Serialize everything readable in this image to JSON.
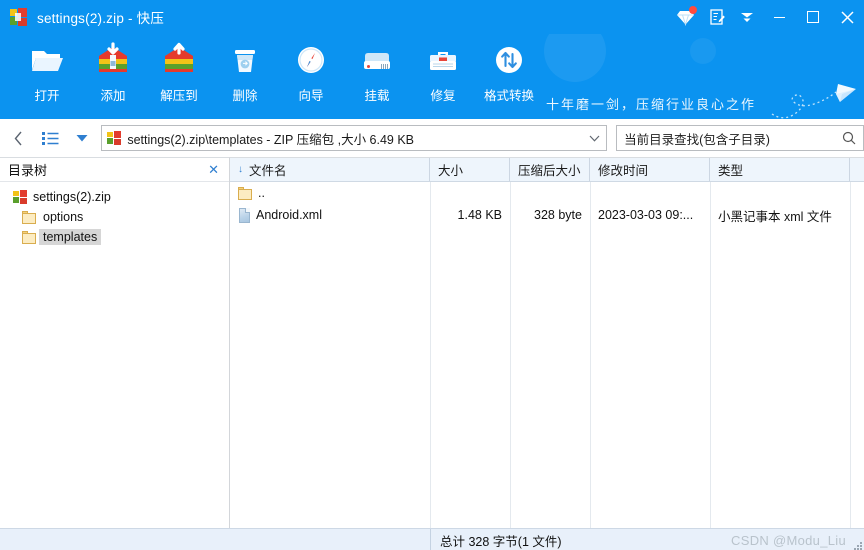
{
  "window": {
    "title": "settings(2).zip - 快压",
    "app_icon": "zip-archive-icon",
    "controls": {
      "vip": "vip-diamond-icon",
      "feedback": "feedback-note-icon",
      "menu": "chevron-down-icon",
      "minimize": "minimize-icon",
      "maximize": "maximize-icon",
      "close": "close-icon"
    }
  },
  "toolbar": {
    "buttons": [
      {
        "label": "打开",
        "icon": "open-folder-icon"
      },
      {
        "label": "添加",
        "icon": "add-archive-icon"
      },
      {
        "label": "解压到",
        "icon": "extract-archive-icon"
      },
      {
        "label": "删除",
        "icon": "trash-icon"
      },
      {
        "label": "向导",
        "icon": "compass-icon"
      },
      {
        "label": "挂载",
        "icon": "mount-disk-icon"
      },
      {
        "label": "修复",
        "icon": "toolbox-repair-icon"
      },
      {
        "label": "格式转换",
        "icon": "convert-arrows-icon"
      }
    ],
    "slogan": "十年磨一剑，压缩行业良心之作"
  },
  "address": {
    "back_icon": "back-chevron-icon",
    "list_icon": "list-view-icon",
    "dropdown_icon": "dropdown-triangle-icon",
    "path": "settings(2).zip\\templates - ZIP 压缩包 ,大小 6.49 KB",
    "path_icon": "zip-archive-icon",
    "caret_icon": "chevron-down-icon"
  },
  "search": {
    "placeholder": "当前目录查找(包含子目录)",
    "icon": "search-icon"
  },
  "tree": {
    "title": "目录树",
    "close_label": "✕",
    "nodes": [
      {
        "label": "settings(2).zip",
        "icon": "zip-archive-icon",
        "level": 1,
        "selected": false
      },
      {
        "label": "options",
        "icon": "folder-icon",
        "level": 2,
        "selected": false
      },
      {
        "label": "templates",
        "icon": "folder-icon",
        "level": 2,
        "selected": true
      }
    ]
  },
  "filelist": {
    "columns": [
      {
        "key": "name",
        "label": "文件名",
        "sorted": true
      },
      {
        "key": "size",
        "label": "大小"
      },
      {
        "key": "csize",
        "label": "压缩后大小"
      },
      {
        "key": "time",
        "label": "修改时间"
      },
      {
        "key": "type",
        "label": "类型"
      }
    ],
    "rows": [
      {
        "name": "..",
        "icon": "folder-up-icon",
        "size": "",
        "csize": "",
        "time": "",
        "type": ""
      },
      {
        "name": "Android.xml",
        "icon": "xml-file-icon",
        "size": "1.48 KB",
        "csize": "328 byte",
        "time": "2023-03-03   09:...",
        "type": "小黑记事本 xml 文件"
      }
    ]
  },
  "status": {
    "summary": "总计  328 字节(1 文件)",
    "watermark": "CSDN @Modu_Liu"
  },
  "colors": {
    "brand_blue": "#0b93f0",
    "header_blue": "#eef5fc",
    "status_blue": "#e8f0fa",
    "accent_link": "#2f7fd0"
  }
}
